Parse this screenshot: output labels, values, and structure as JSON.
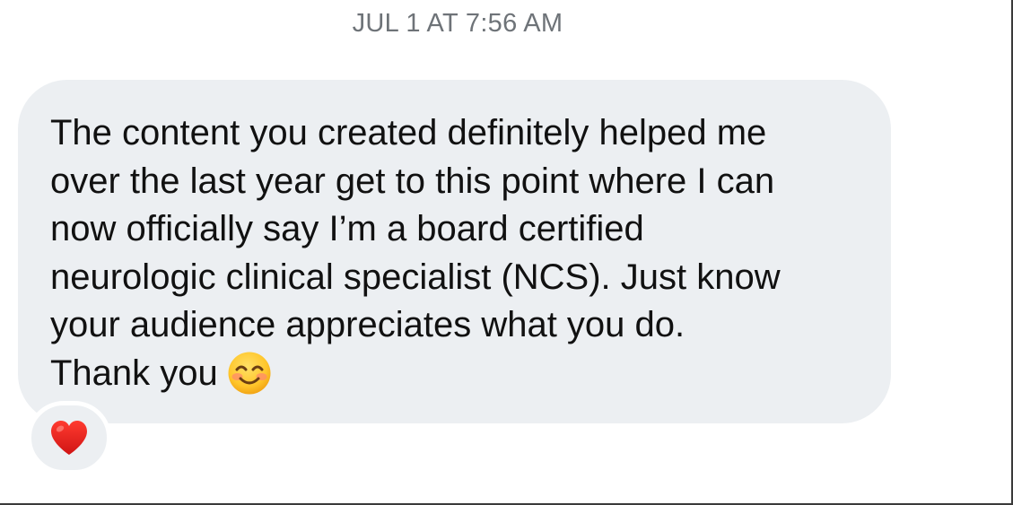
{
  "conversation": {
    "timestamp": "JUL 1 AT 7:56 AM",
    "message": {
      "text": "The content you created definitely helped me\nover the last year get to this point where I can\nnow officially say I’m a board certified\nneurologic clinical specialist (NCS). Just know\nyour audience appreciates what you do.\nThank you",
      "emoji": "smiling-face-with-smiling-eyes-icon",
      "bubble_color": "#eceff2"
    },
    "reaction": {
      "emoji": "red-heart-icon",
      "color": "#e0241b"
    }
  }
}
